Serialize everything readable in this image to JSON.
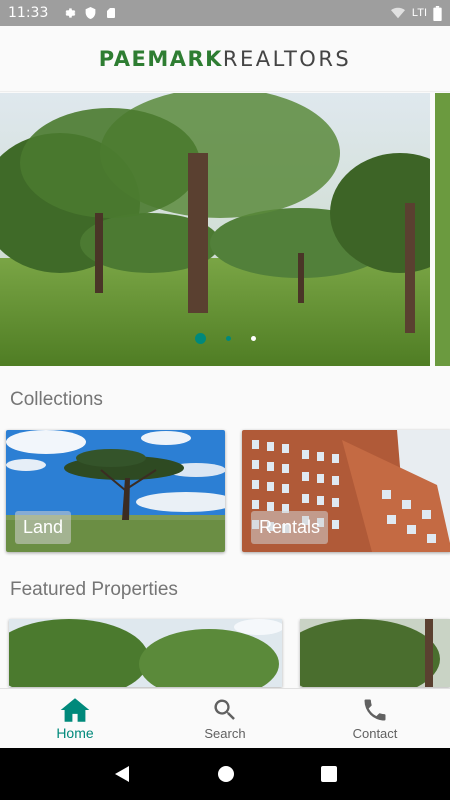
{
  "status_bar": {
    "time": "11:33",
    "network": "LTI",
    "icons": [
      "gear-icon",
      "shield-icon",
      "sd-card-icon",
      "wifi-icon",
      "battery-icon"
    ]
  },
  "header": {
    "logo_part1": "PAEMARK",
    "logo_part2": "REALTORS",
    "brand_color": "#2e7d32"
  },
  "carousel": {
    "slide_count": 3,
    "active_index": 0,
    "dot_active_color": "#00897b"
  },
  "collections": {
    "title": "Collections",
    "items": [
      {
        "label": "Land"
      },
      {
        "label": "Rentals"
      }
    ]
  },
  "featured": {
    "title": "Featured Properties"
  },
  "bottom_nav": {
    "accent": "#00897b",
    "items": [
      {
        "label": "Home",
        "icon": "home-icon",
        "active": true
      },
      {
        "label": "Search",
        "icon": "search-icon",
        "active": false
      },
      {
        "label": "Contact",
        "icon": "phone-icon",
        "active": false
      }
    ]
  },
  "system_nav": {
    "icons": [
      "back-icon",
      "home-circle-icon",
      "recents-icon"
    ]
  }
}
